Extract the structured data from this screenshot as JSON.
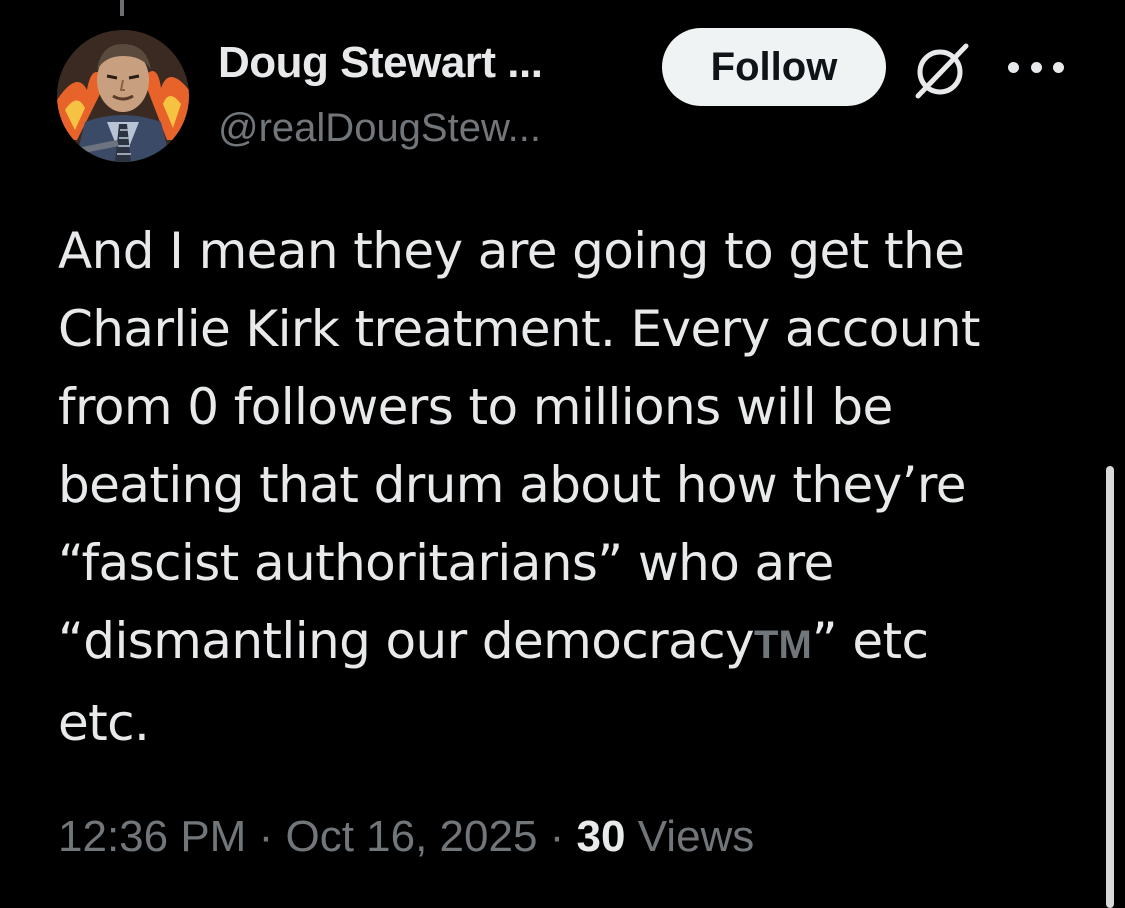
{
  "author": {
    "name": "Doug Stewart ...",
    "handle": "@realDougStew...",
    "avatar_icon": "comic-avatar-icon"
  },
  "actions": {
    "follow_label": "Follow",
    "grok_icon": "grok-icon",
    "more_icon": "more-options-icon"
  },
  "tweet": {
    "text_line1": "And I mean they are going to get the",
    "text_line2": "Charlie Kirk treatment. Every account",
    "text_line3": "from 0 followers to millions will be",
    "text_line4": "beating that drum about how they’re",
    "text_line5": "“fascist authoritarians” who are",
    "text_line6_start": "“dismantling our democracy",
    "text_line6_tm": "TM",
    "text_line6_end": "” etc",
    "text_line7": "etc."
  },
  "meta": {
    "time": "12:36 PM",
    "separator": "·",
    "date": "Oct 16, 2025",
    "views_count": "30",
    "views_label": "Views"
  },
  "colors": {
    "background": "#000000",
    "primary_text": "#e7e9ea",
    "secondary_text": "#71767b",
    "follow_bg": "#eff3f4"
  }
}
